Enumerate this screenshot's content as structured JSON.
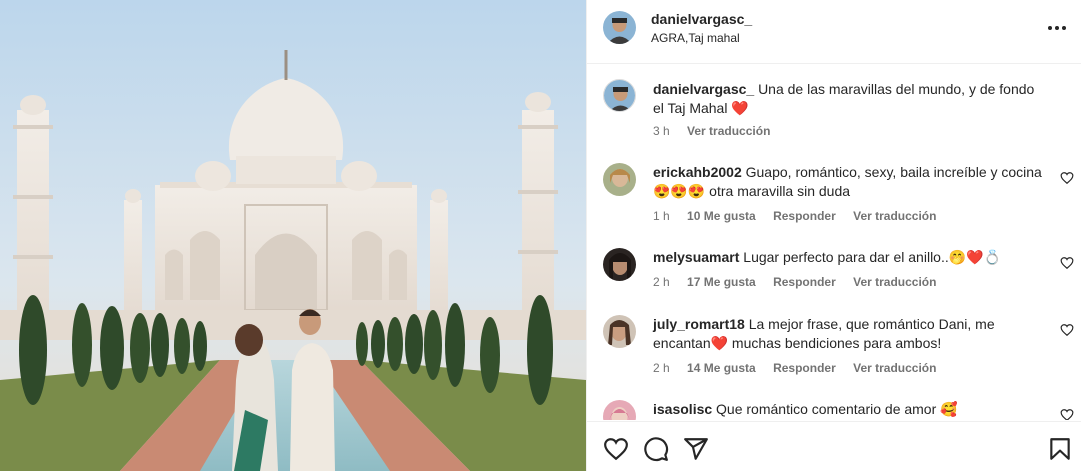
{
  "post": {
    "username": "danielvargasc_",
    "location": "AGRA,Taj mahal",
    "photo_alt": "Pareja frente al Taj Mahal"
  },
  "caption": {
    "username": "danielvargasc_",
    "text": "Una de las maravillas del mundo, y de fondo el Taj Mahal ❤️",
    "time": "3 h",
    "translate": "Ver traducción"
  },
  "comments": [
    {
      "username": "erickahb2002",
      "text": "Guapo, romántico, sexy, baila increíble y cocina 😍😍😍 otra maravilla sin duda",
      "time": "1 h",
      "likes": "10 Me gusta",
      "reply": "Responder",
      "translate": "Ver traducción"
    },
    {
      "username": "melysuamart",
      "text": "Lugar perfecto para dar el anillo..🤭❤️💍",
      "time": "2 h",
      "likes": "17 Me gusta",
      "reply": "Responder",
      "translate": "Ver traducción"
    },
    {
      "username": "july_romart18",
      "text": "La mejor frase, que romántico Dani, me encantan❤️ muchas bendiciones para ambos!",
      "time": "2 h",
      "likes": "14 Me gusta",
      "reply": "Responder",
      "translate": "Ver traducción"
    },
    {
      "username": "isasolisc",
      "text": "Que romántico comentario de amor 🥰",
      "time": "",
      "likes": "",
      "reply": "",
      "translate": ""
    }
  ],
  "icons": {
    "more": "more-options-icon",
    "like": "heart-icon",
    "comment": "comment-icon",
    "share": "share-icon",
    "save": "bookmark-icon"
  },
  "colors": {
    "text": "#262626",
    "meta": "#737373",
    "border": "#efefef"
  }
}
